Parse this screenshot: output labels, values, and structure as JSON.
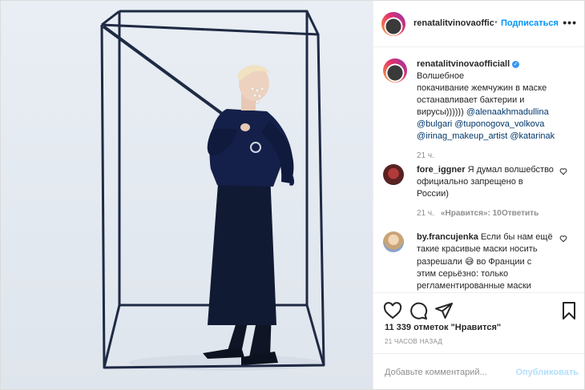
{
  "header": {
    "username": "renatalitvinovaoffici",
    "dot": "•",
    "follow_label": "Подписаться",
    "more_icon": "more-horizontal-icon"
  },
  "caption": {
    "username": "renatalitvinovaofficiall",
    "verified_icon": "verified-badge-icon",
    "text_line1": "Волшебное",
    "text_line2": "покачивание жемчужин в маске",
    "text_line3": "останавливает бактерии и",
    "text_line4": "вирусы)))))) ",
    "mention1": "@alenaakhmadullina",
    "mention2": "@bulgari",
    "mention3": "@tuponogova_volkova",
    "mention4": "@irinag_makeup_artist",
    "mention5": "@katarinak",
    "time": "21 ч."
  },
  "comments": [
    {
      "username": "fore_iggner",
      "text_line1": "Я думал волшебство",
      "text_line2": "официально запрещено в",
      "text_line3": "России)",
      "time": "21 ч.",
      "likes": "«Нравится»: 10",
      "reply_label": "Ответить"
    },
    {
      "username": "by.francujenka",
      "text_line1": "Если бы нам ещё",
      "text_line2": "такие красивые маски носить",
      "text_line3a": "разрешали",
      "text_line3b": "во Франции с",
      "text_line4": "этим серьёзно: только",
      "text_line5": "регламентированные маски",
      "emoji": "😅"
    }
  ],
  "actions": {
    "like_icon": "heart-icon",
    "comment_icon": "comment-icon",
    "share_icon": "share-icon",
    "save_icon": "bookmark-icon"
  },
  "likes_text": "11 339 отметок \"Нравится\"",
  "post_time": "21 часов назад",
  "add_comment": {
    "placeholder": "Добавьте комментарий...",
    "post_label": "Опубликовать"
  },
  "colors": {
    "accent": "#0095f6",
    "post_disabled": "#b2dffc",
    "border": "#efefef"
  }
}
